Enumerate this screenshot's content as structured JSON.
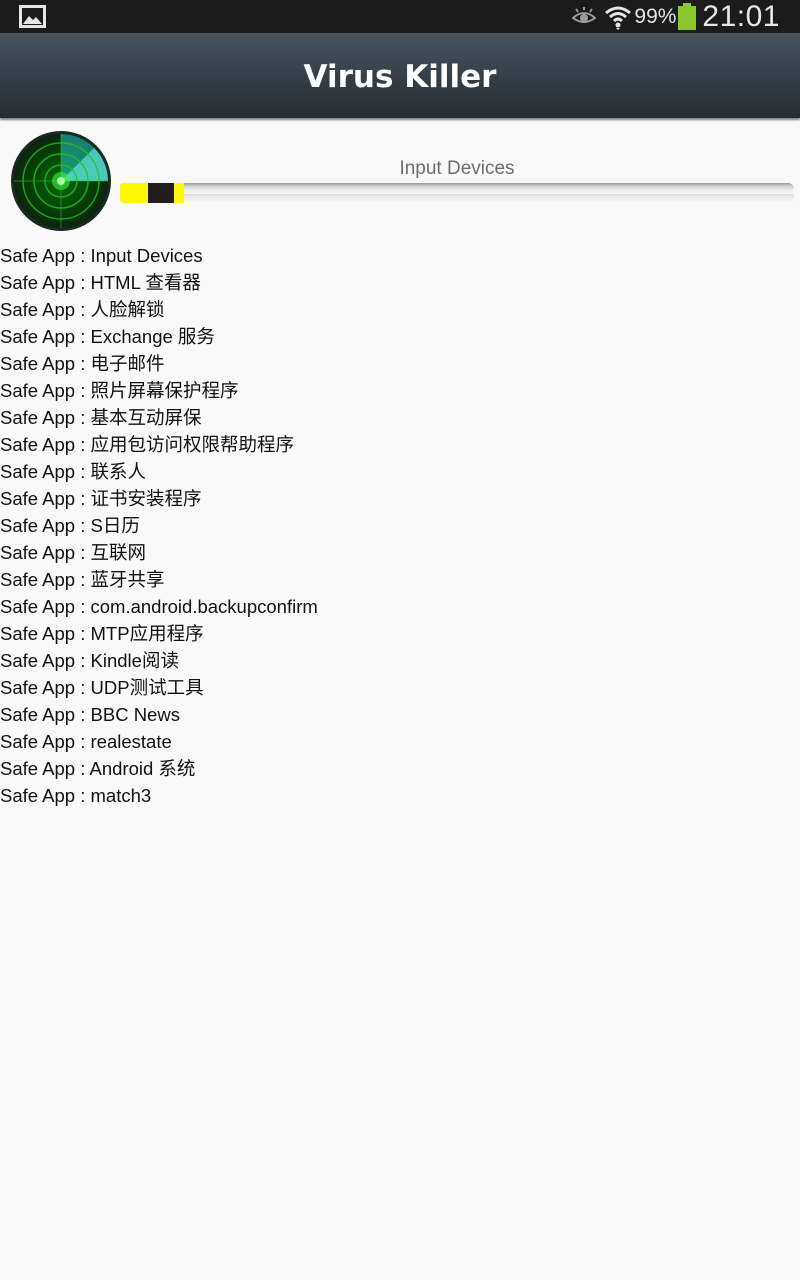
{
  "status_bar": {
    "battery_percent": "99%",
    "time": "21:01",
    "icons": [
      "gallery-icon",
      "eye-icon",
      "wifi-icon",
      "battery-icon"
    ],
    "battery_color": "#8ac72a"
  },
  "action_bar": {
    "title": "Virus Killer"
  },
  "scan": {
    "current_item": "Input Devices",
    "progress_fraction": 0.095,
    "progress_colors": [
      "#fff700",
      "#231c1c"
    ]
  },
  "results": {
    "prefix": "Safe App : ",
    "items": [
      "Safe App : Input Devices",
      "Safe App : HTML 查看器",
      "Safe App : 人脸解锁",
      "Safe App : Exchange 服务",
      "Safe App : 电子邮件",
      "Safe App : 照片屏幕保护程序",
      "Safe App : 基本互动屏保",
      "Safe App : 应用包访问权限帮助程序",
      "Safe App : 联系人",
      "Safe App : 证书安装程序",
      "Safe App : S日历",
      "Safe App : 互联网",
      "Safe App : 蓝牙共享",
      "Safe App : com.android.backupconfirm",
      "Safe App : MTP应用程序",
      "Safe App : Kindle阅读",
      "Safe App : UDP测试工具",
      "Safe App : BBC News",
      "Safe App : realestate",
      "Safe App : Android 系统",
      "Safe App : match3"
    ]
  }
}
